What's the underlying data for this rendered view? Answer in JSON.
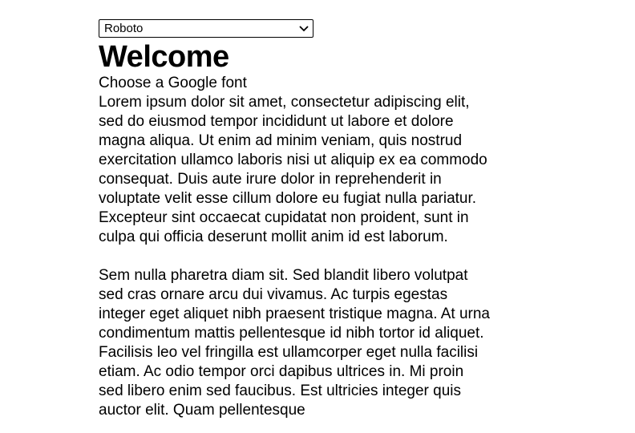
{
  "font_select": {
    "selected": "Roboto"
  },
  "heading": "Welcome",
  "subtitle": "Choose a Google font",
  "paragraphs": [
    "Lorem ipsum dolor sit amet, consectetur adipiscing elit, sed do eiusmod tempor incididunt ut labore et dolore magna aliqua. Ut enim ad minim veniam, quis nostrud exercitation ullamco laboris nisi ut aliquip ex ea commodo consequat. Duis aute irure dolor in reprehenderit in voluptate velit esse cillum dolore eu fugiat nulla pariatur. Excepteur sint occaecat cupidatat non proident, sunt in culpa qui officia deserunt mollit anim id est laborum.",
    "Sem nulla pharetra diam sit. Sed blandit libero volutpat sed cras ornare arcu dui vivamus. Ac turpis egestas integer eget aliquet nibh praesent tristique magna. At urna condimentum mattis pellentesque id nibh tortor id aliquet. Facilisis leo vel fringilla est ullamcorper eget nulla facilisi etiam. Ac odio tempor orci dapibus ultrices in. Mi proin sed libero enim sed faucibus. Est ultricies integer quis auctor elit. Quam pellentesque"
  ]
}
